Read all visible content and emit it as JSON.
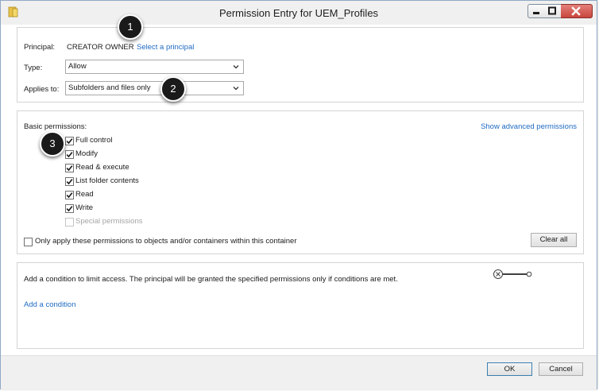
{
  "window": {
    "title": "Permission Entry for UEM_Profiles"
  },
  "principal": {
    "label": "Principal:",
    "value": "CREATOR OWNER",
    "select_link": "Select a principal"
  },
  "type": {
    "label": "Type:",
    "value": "Allow"
  },
  "applies_to": {
    "label": "Applies to:",
    "value": "Subfolders and files only"
  },
  "permissions": {
    "heading": "Basic permissions:",
    "advanced_link": "Show advanced permissions",
    "items": [
      {
        "label": "Full control",
        "checked": true,
        "enabled": true
      },
      {
        "label": "Modify",
        "checked": true,
        "enabled": true
      },
      {
        "label": "Read & execute",
        "checked": true,
        "enabled": true
      },
      {
        "label": "List folder contents",
        "checked": true,
        "enabled": true
      },
      {
        "label": "Read",
        "checked": true,
        "enabled": true
      },
      {
        "label": "Write",
        "checked": true,
        "enabled": true
      },
      {
        "label": "Special permissions",
        "checked": false,
        "enabled": false
      }
    ],
    "only_apply_label": "Only apply these permissions to objects and/or containers within this container",
    "only_apply_checked": false,
    "clear_all": "Clear all"
  },
  "condition": {
    "description": "Add a condition to limit access. The principal will be granted the specified permissions only if conditions are met.",
    "add_link": "Add a condition"
  },
  "buttons": {
    "ok": "OK",
    "cancel": "Cancel"
  },
  "callouts": [
    "1",
    "2",
    "3"
  ]
}
